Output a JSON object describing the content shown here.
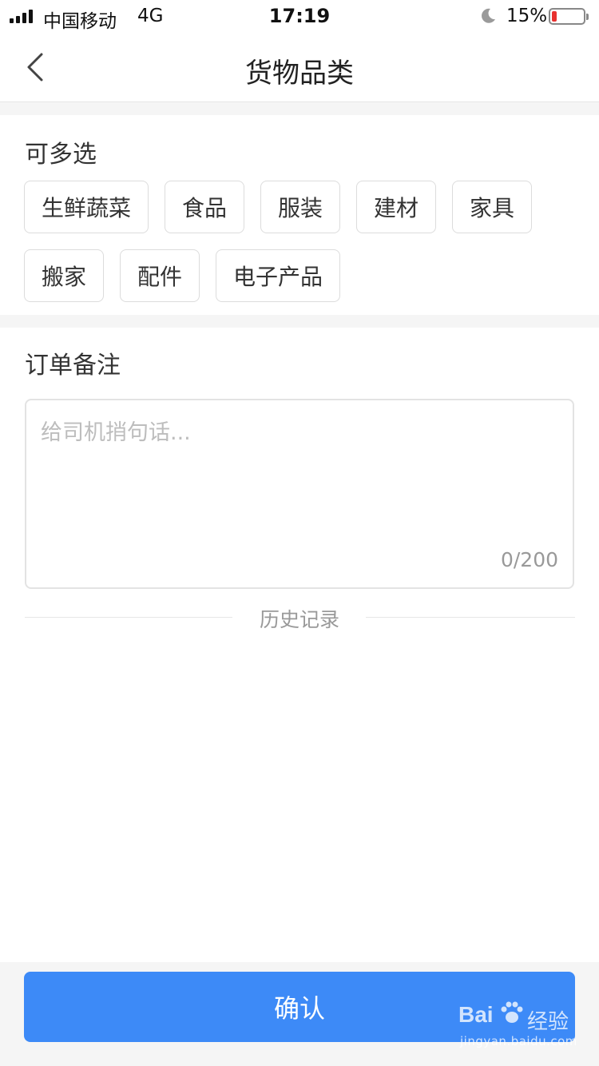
{
  "status_bar": {
    "carrier": "中国移动",
    "network": "4G",
    "time": "17:19",
    "battery_percent": "15%",
    "battery_level": 0.15,
    "battery_color": "#e8312f"
  },
  "nav": {
    "back_icon": "chevron-left-icon",
    "title": "货物品类"
  },
  "category": {
    "title": "可多选",
    "tags": [
      "生鲜蔬菜",
      "食品",
      "服装",
      "建材",
      "家具",
      "搬家",
      "配件",
      "电子产品"
    ]
  },
  "remark": {
    "title": "订单备注",
    "value": "",
    "placeholder": "给司机捎句话...",
    "char_count": "0/200",
    "history_label": "历史记录"
  },
  "footer": {
    "confirm_label": "确认",
    "accent_color": "#3d8af7"
  },
  "watermark": {
    "logo": "Bai",
    "suffix": "经验",
    "url": "jingyan.baidu.com"
  }
}
